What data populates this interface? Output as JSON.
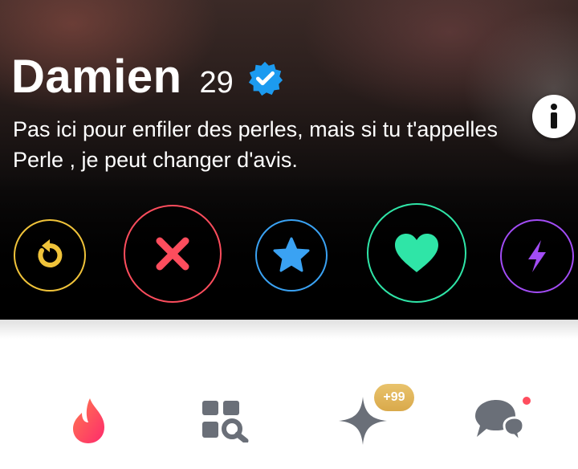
{
  "profile": {
    "name": "Damien",
    "age": "29",
    "bio": "Pas ici pour enfiler des perles, mais si tu t'appelles Perle , je peut changer d'avis."
  },
  "actions": [
    {
      "id": "rewind",
      "icon": "rewind-icon",
      "color": "#f0c33a"
    },
    {
      "id": "nope",
      "icon": "close-icon",
      "color": "#fd4d5d"
    },
    {
      "id": "super_like",
      "icon": "star-icon",
      "color": "#3aa2f3"
    },
    {
      "id": "like",
      "icon": "heart-icon",
      "color": "#2fe5a7"
    },
    {
      "id": "boost",
      "icon": "lightning-icon",
      "color": "#a24cf5"
    }
  ],
  "nav": {
    "items": [
      {
        "id": "home",
        "icon": "flame-icon",
        "color": "#fd4d5d"
      },
      {
        "id": "explore",
        "icon": "explore-grid-icon",
        "color": "#6a6f78"
      },
      {
        "id": "gold",
        "icon": "sparkle-icon",
        "color": "#6a6f78"
      },
      {
        "id": "messages",
        "icon": "chat-bubbles-icon",
        "color": "#6a6f78"
      }
    ],
    "gold_badge": "+99"
  }
}
